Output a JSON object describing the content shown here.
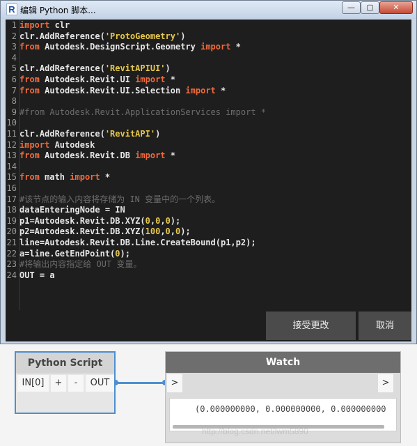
{
  "window": {
    "title": "编辑 Python 脚本...",
    "icon": "revit-r-icon",
    "controls": {
      "minimize": "—",
      "maximize": "▢",
      "close": "✕"
    }
  },
  "editor": {
    "lines": [
      {
        "n": "1",
        "parts": [
          [
            "kw",
            "import"
          ],
          [
            "df",
            " clr"
          ]
        ]
      },
      {
        "n": "2",
        "parts": [
          [
            "df",
            "clr.AddReference("
          ],
          [
            "st",
            "'ProtoGeometry'"
          ],
          [
            "df",
            ")"
          ]
        ]
      },
      {
        "n": "3",
        "parts": [
          [
            "kw",
            "from"
          ],
          [
            "df",
            " Autodesk.DesignScript.Geometry "
          ],
          [
            "kw",
            "import"
          ],
          [
            "df",
            " *"
          ]
        ]
      },
      {
        "n": "4",
        "parts": []
      },
      {
        "n": "5",
        "parts": [
          [
            "df",
            "clr.AddReference("
          ],
          [
            "st",
            "'RevitAPIUI'"
          ],
          [
            "df",
            ")"
          ]
        ]
      },
      {
        "n": "6",
        "parts": [
          [
            "kw",
            "from"
          ],
          [
            "df",
            " Autodesk.Revit.UI "
          ],
          [
            "kw",
            "import"
          ],
          [
            "df",
            " *"
          ]
        ]
      },
      {
        "n": "7",
        "parts": [
          [
            "kw",
            "from"
          ],
          [
            "df",
            " Autodesk.Revit.UI.Selection "
          ],
          [
            "kw",
            "import"
          ],
          [
            "df",
            " *"
          ]
        ]
      },
      {
        "n": "8",
        "parts": []
      },
      {
        "n": "9",
        "parts": [
          [
            "cm",
            "#from Autodesk.Revit.ApplicationServices import *"
          ]
        ]
      },
      {
        "n": "10",
        "parts": []
      },
      {
        "n": "11",
        "parts": [
          [
            "df",
            "clr.AddReference("
          ],
          [
            "st",
            "'RevitAPI'"
          ],
          [
            "df",
            ")"
          ]
        ]
      },
      {
        "n": "12",
        "parts": [
          [
            "kw",
            "import"
          ],
          [
            "df",
            " Autodesk"
          ]
        ]
      },
      {
        "n": "13",
        "parts": [
          [
            "kw",
            "from"
          ],
          [
            "df",
            " Autodesk.Revit.DB "
          ],
          [
            "kw",
            "import"
          ],
          [
            "df",
            " *"
          ]
        ]
      },
      {
        "n": "14",
        "parts": []
      },
      {
        "n": "15",
        "parts": [
          [
            "kw",
            "from"
          ],
          [
            "df",
            " math "
          ],
          [
            "kw",
            "import"
          ],
          [
            "df",
            " *"
          ]
        ]
      },
      {
        "n": "16",
        "parts": []
      },
      {
        "n": "17",
        "parts": [
          [
            "cm",
            "#该节点的输入内容将存储为 IN 变量中的一个列表。"
          ]
        ]
      },
      {
        "n": "18",
        "parts": [
          [
            "df",
            "dataEnteringNode = IN"
          ]
        ]
      },
      {
        "n": "19",
        "parts": [
          [
            "df",
            "p1=Autodesk.Revit.DB.XYZ("
          ],
          [
            "nm",
            "0"
          ],
          [
            "df",
            ","
          ],
          [
            "nm",
            "0"
          ],
          [
            "df",
            ","
          ],
          [
            "nm",
            "0"
          ],
          [
            "df",
            ");"
          ]
        ]
      },
      {
        "n": "20",
        "parts": [
          [
            "df",
            "p2=Autodesk.Revit.DB.XYZ("
          ],
          [
            "nm",
            "100"
          ],
          [
            "df",
            ","
          ],
          [
            "nm",
            "0"
          ],
          [
            "df",
            ","
          ],
          [
            "nm",
            "0"
          ],
          [
            "df",
            ");"
          ]
        ]
      },
      {
        "n": "21",
        "parts": [
          [
            "df",
            "line=Autodesk.Revit.DB.Line.CreateBound(p1,p2);"
          ]
        ]
      },
      {
        "n": "22",
        "parts": [
          [
            "df",
            "a=line.GetEndPoint("
          ],
          [
            "nm",
            "0"
          ],
          [
            "df",
            ");"
          ]
        ]
      },
      {
        "n": "23",
        "parts": [
          [
            "cm",
            "#将输出内容指定给 OUT 变量。"
          ]
        ]
      },
      {
        "n": "24",
        "parts": [
          [
            "df",
            "OUT = a"
          ]
        ]
      }
    ]
  },
  "footer": {
    "accept_label": "接受更改",
    "cancel_label": "取消"
  },
  "nodes": {
    "python_script": {
      "title": "Python Script",
      "ports": {
        "input": "IN[0]",
        "add": "+",
        "remove": "-",
        "output": "OUT"
      }
    },
    "watch": {
      "title": "Watch",
      "input_port": ">",
      "output_port": ">",
      "value": "(0.000000000, 0.000000000, 0.000000000"
    }
  },
  "watermark": "http://blog.csdn.net/lwm5890",
  "colors": {
    "keyword": "#f06a3c",
    "string": "#e6c84a",
    "comment": "#6d6d6d",
    "editor_bg": "#1e1e1e",
    "selection_blue": "#4d8fd1"
  }
}
